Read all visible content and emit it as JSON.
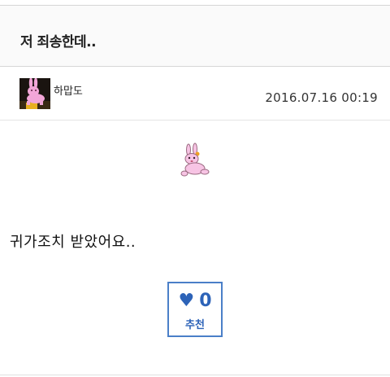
{
  "post": {
    "title": "저 죄송한데..",
    "author": "하맙도",
    "date": "2016.07.16 00:19",
    "body": "귀가조치 받았어요.."
  },
  "recommend": {
    "heart_icon": "heart-icon",
    "count": "0",
    "label": "추천"
  },
  "colors": {
    "accent": "#2d63b8",
    "border_accent": "#4a7fc8",
    "avatar_bg": "#1a1410",
    "bunny_pink": "#f2a6d8"
  }
}
